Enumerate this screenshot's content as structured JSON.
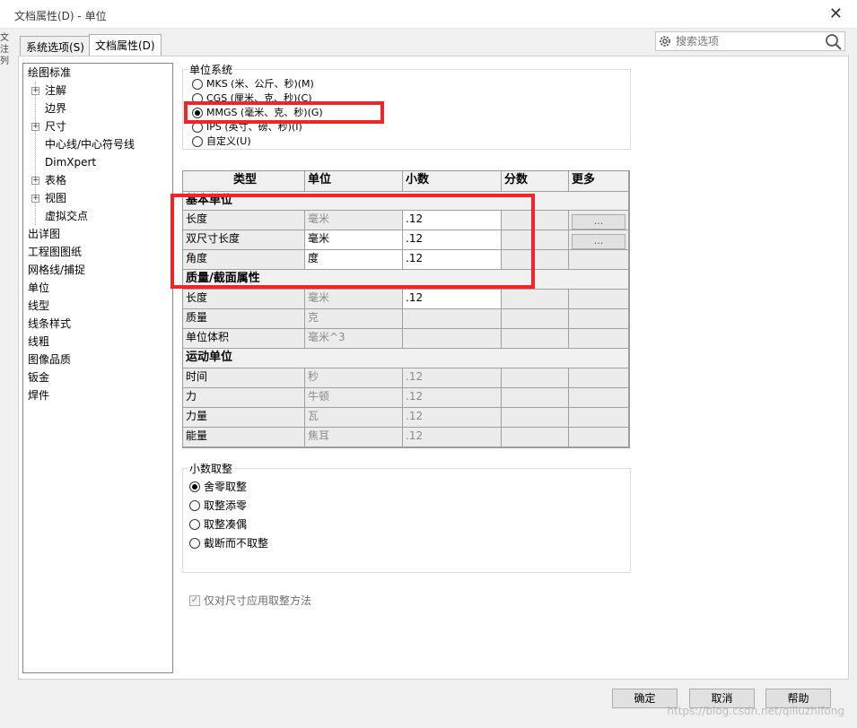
{
  "window": {
    "title": "文档属性(D) - 单位"
  },
  "tabs": [
    "系统选项(S)",
    "文档属性(D)"
  ],
  "search": {
    "placeholder": "搜索选项"
  },
  "left_stub_chars": [
    "文",
    "注",
    "列"
  ],
  "tree": {
    "items": [
      {
        "label": "绘图标准"
      },
      {
        "label": "注解",
        "expander": "+"
      },
      {
        "label": "边界"
      },
      {
        "label": "尺寸",
        "expander": "+"
      },
      {
        "label": "中心线/中心符号线"
      },
      {
        "label": "DimXpert"
      },
      {
        "label": "表格",
        "expander": "+"
      },
      {
        "label": "视图",
        "expander": "+"
      },
      {
        "label": "虚拟交点"
      },
      {
        "label": "出详图"
      },
      {
        "label": "工程图图纸"
      },
      {
        "label": "网格线/捕捉"
      },
      {
        "label": "单位",
        "selected": true
      },
      {
        "label": "线型"
      },
      {
        "label": "线条样式"
      },
      {
        "label": "线粗"
      },
      {
        "label": "图像品质"
      },
      {
        "label": "钣金"
      },
      {
        "label": "焊件"
      }
    ]
  },
  "unit_system": {
    "label": "单位系统",
    "options": [
      {
        "label": "MKS (米、公斤、秒)(M)",
        "selected": false
      },
      {
        "label": "CGS (厘米、克、秒)(C)",
        "selected": false
      },
      {
        "label": "MMGS (毫米、克、秒)(G)",
        "selected": true
      },
      {
        "label": "IPS (英寸、磅、秒)(I)",
        "selected": false
      },
      {
        "label": "自定义(U)",
        "selected": false
      }
    ]
  },
  "units_table": {
    "headers": [
      "类型",
      "单位",
      "小数",
      "分数",
      "更多"
    ],
    "more_button": "...",
    "groups": [
      {
        "title": "基本单位",
        "rows": [
          {
            "type": "长度",
            "unit": "毫米",
            "decimal": ".12",
            "more": true
          },
          {
            "type": "双尺寸长度",
            "unit": "毫米",
            "decimal": ".12",
            "more": true
          },
          {
            "type": "角度",
            "unit": "度",
            "decimal": ".12",
            "more": false
          }
        ]
      },
      {
        "title": "质量/截面属性",
        "rows": [
          {
            "type": "长度",
            "unit": "毫米",
            "decimal": ".12",
            "more": false
          },
          {
            "type": "质量",
            "unit": "克",
            "decimal": "",
            "more": false
          },
          {
            "type": "单位体积",
            "unit": "毫米^3",
            "decimal": "",
            "more": false
          }
        ]
      },
      {
        "title": "运动单位",
        "rows": [
          {
            "type": "时间",
            "unit": "秒",
            "decimal": ".12",
            "more": false
          },
          {
            "type": "力",
            "unit": "牛顿",
            "decimal": ".12",
            "more": false
          },
          {
            "type": "力量",
            "unit": "瓦",
            "decimal": ".12",
            "more": false
          },
          {
            "type": "能量",
            "unit": "焦耳",
            "decimal": ".12",
            "more": false
          }
        ]
      }
    ]
  },
  "rounding": {
    "label": "小数取整",
    "options": [
      {
        "label": "舍零取整",
        "selected": true
      },
      {
        "label": "取整添零",
        "selected": false
      },
      {
        "label": "取整凑偶",
        "selected": false
      },
      {
        "label": "截断而不取整",
        "selected": false
      }
    ]
  },
  "checkbox": {
    "label": "仅对尺寸应用取整方法",
    "checked": true
  },
  "buttons": {
    "ok": "确定",
    "cancel": "取消",
    "help": "帮助"
  },
  "watermark": "https://blog.csdn.net/qiliuzhifong",
  "colors": {
    "highlight": "#f0252a"
  }
}
